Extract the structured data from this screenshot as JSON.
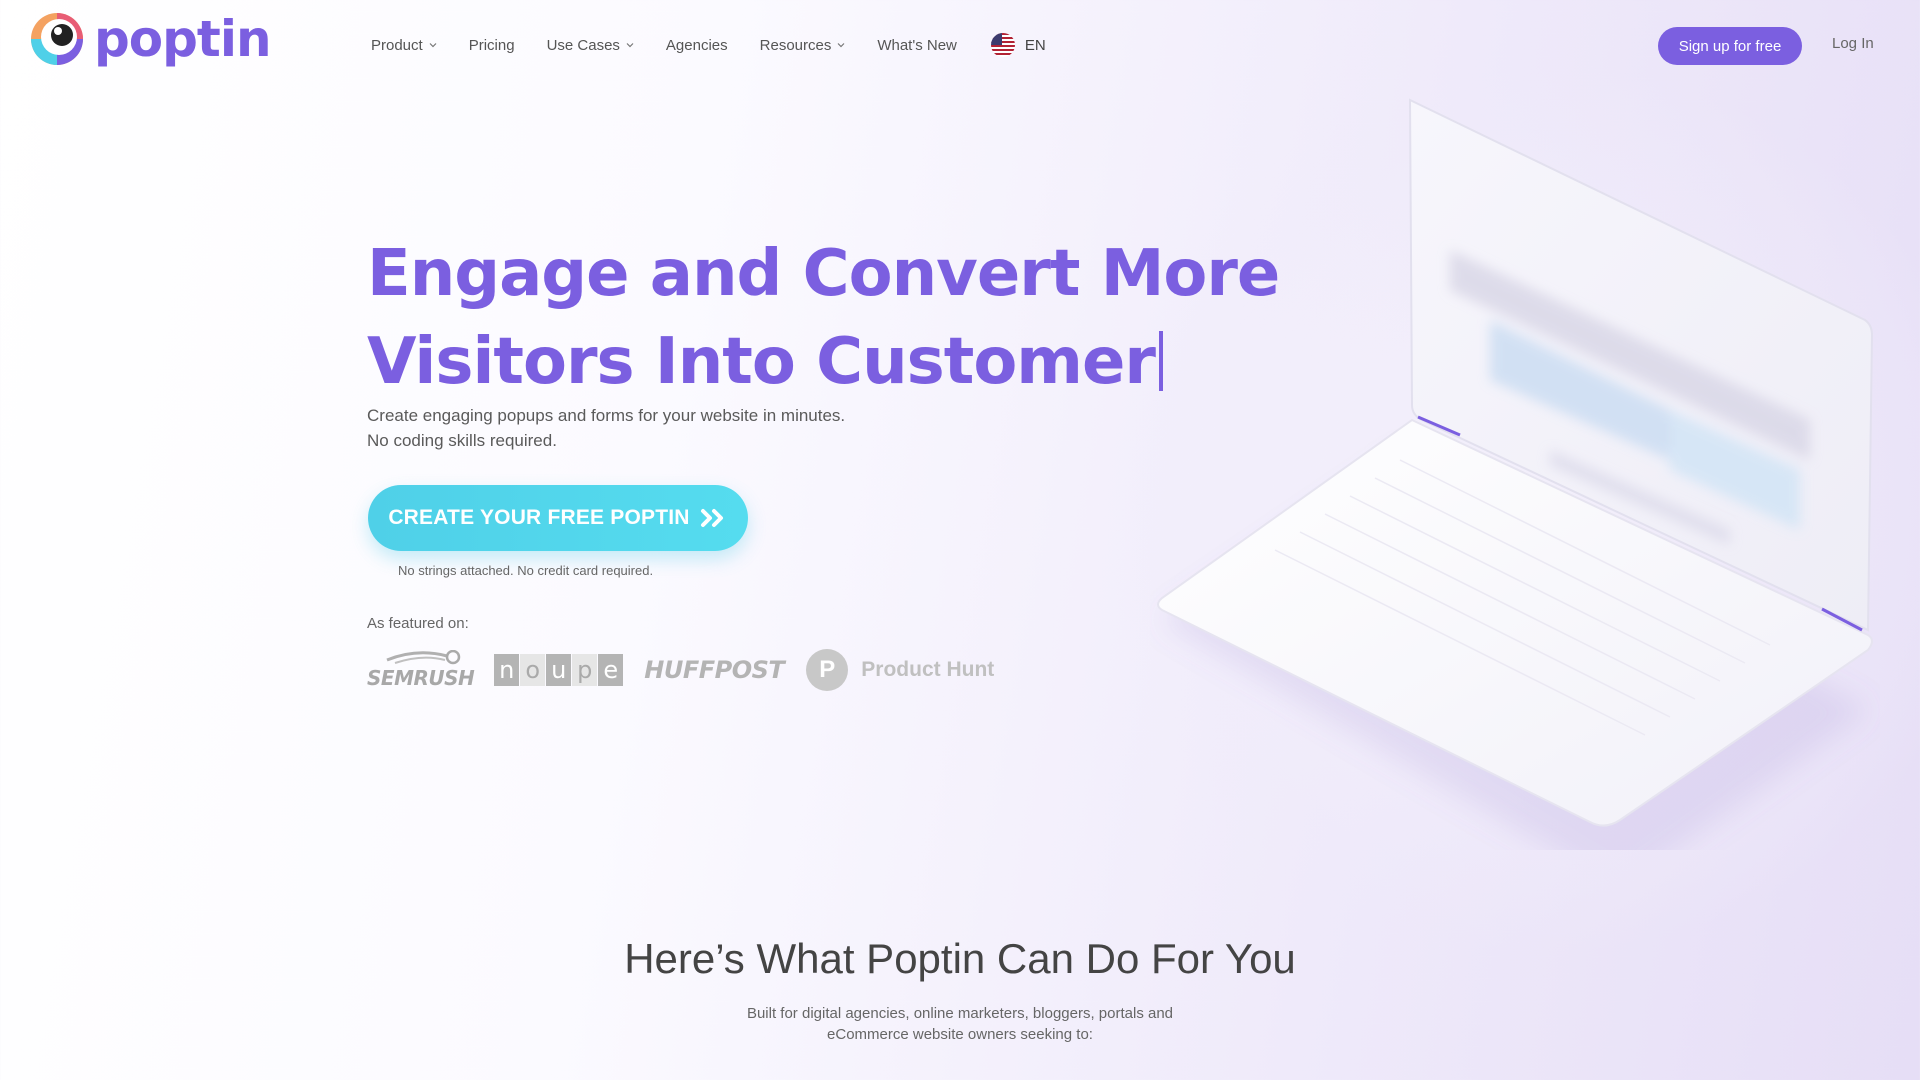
{
  "brand": {
    "name": "poptin",
    "color": "#7b5fe0"
  },
  "nav": {
    "items": [
      {
        "label": "Product",
        "has_dropdown": true
      },
      {
        "label": "Pricing",
        "has_dropdown": false
      },
      {
        "label": "Use Cases",
        "has_dropdown": true
      },
      {
        "label": "Agencies",
        "has_dropdown": false
      },
      {
        "label": "Resources",
        "has_dropdown": true
      },
      {
        "label": "What's New",
        "has_dropdown": false
      }
    ],
    "language": {
      "flag": "us-flag-icon",
      "label": "EN"
    },
    "signup_label": "Sign up for free",
    "login_label": "Log In"
  },
  "hero": {
    "title_line1": "Engage and Convert More",
    "title_line2": "Visitors Into Customer",
    "subtitle_line1": "Create engaging popups and forms for your website in minutes.",
    "subtitle_line2": "No coding skills required.",
    "cta_label": "CREATE YOUR FREE POPTIN",
    "cta_note": "No strings attached. No credit card required.",
    "cta_color": "#4fd0e8"
  },
  "featured": {
    "label": "As featured on:",
    "logos": [
      {
        "name": "semrush",
        "text": "SEMRUSH"
      },
      {
        "name": "noupe",
        "letters": [
          "n",
          "o",
          "u",
          "p",
          "e"
        ]
      },
      {
        "name": "huffpost",
        "text": "HUFFPOST"
      },
      {
        "name": "product-hunt",
        "icon_letter": "P",
        "text": "Product Hunt"
      }
    ]
  },
  "section": {
    "title": "Here’s What Poptin Can Do For You",
    "subtitle_line1": "Built for digital agencies, online marketers, bloggers, portals and",
    "subtitle_line2": "eCommerce website owners seeking to:"
  }
}
